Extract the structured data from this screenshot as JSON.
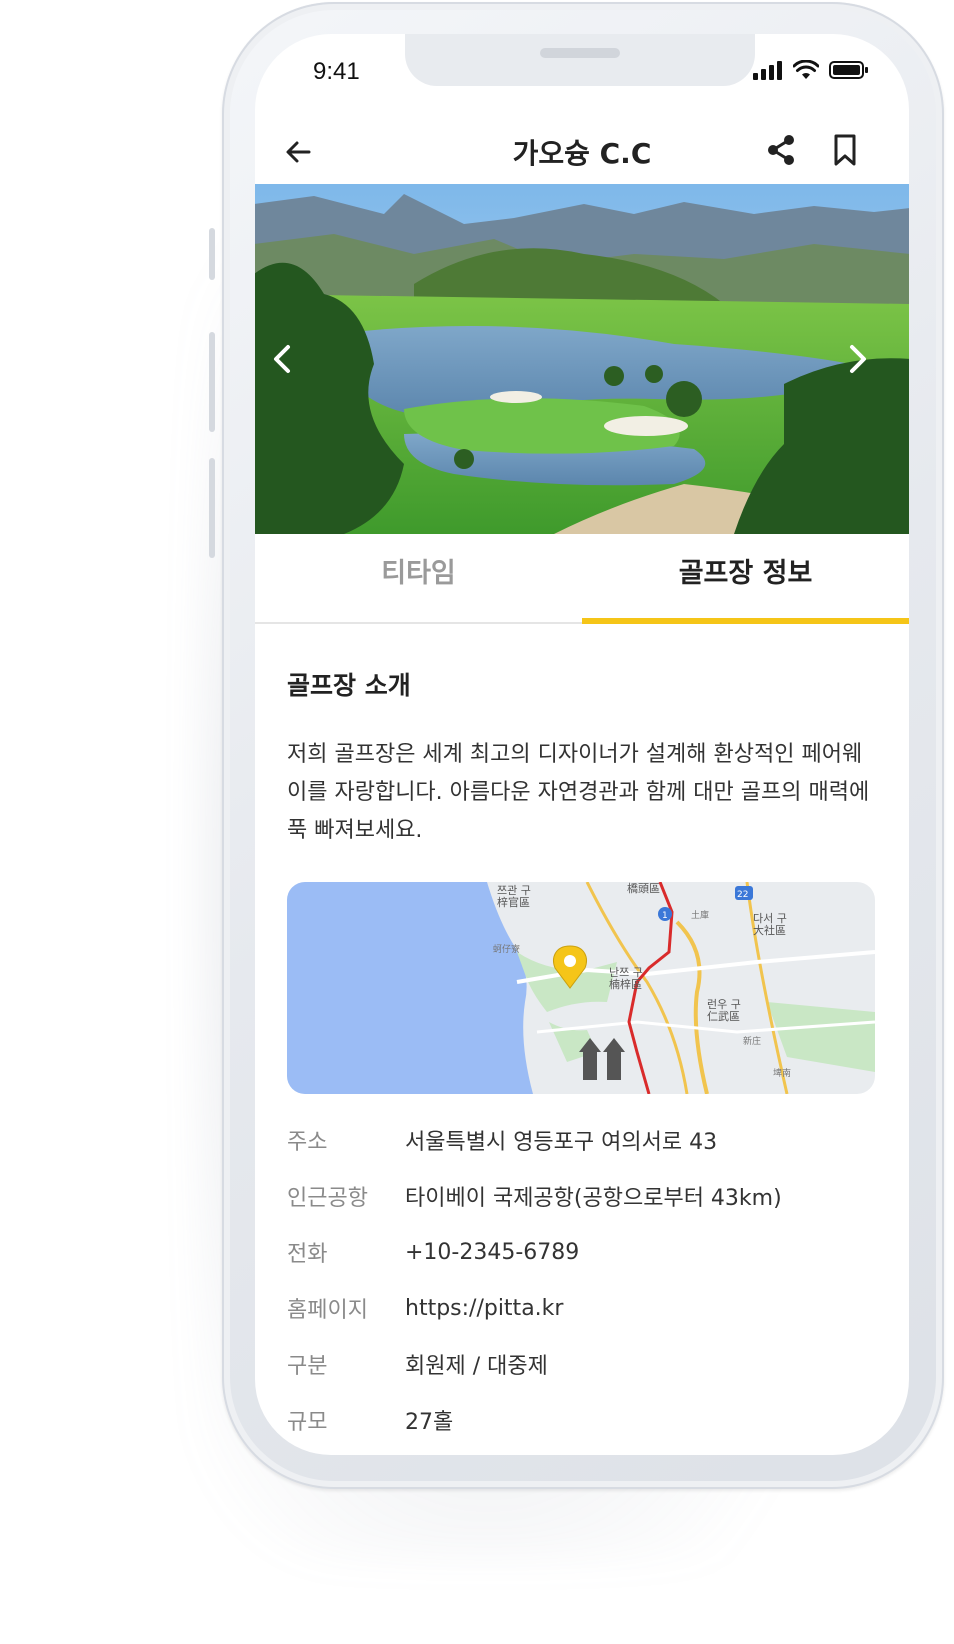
{
  "status_bar": {
    "time": "9:41"
  },
  "header": {
    "title": "가오슝 C.C"
  },
  "tabs": [
    {
      "label": "티타임",
      "active": false
    },
    {
      "label": "골프장 정보",
      "active": true
    }
  ],
  "intro": {
    "title": "골프장 소개",
    "text": "저희 골프장은 세계 최고의 디자이너가 설계해 환상적인 페어웨이를 자랑합니다.  아름다운 자연경관과 함께 대만 골프의 매력에 푹 빠져보세요."
  },
  "map_labels": [
    "쯔관 구",
    "梓官區",
    "橋頭區",
    "22",
    "1",
    "다서 구",
    "大社區",
    "난쯔 구",
    "楠梓區",
    "런우 구",
    "仁武區",
    "蚵仔寮",
    "土庫",
    "新庄",
    "埤南"
  ],
  "info": [
    {
      "label": "주소",
      "value": "서울특별시 영등포구 여의서로 43"
    },
    {
      "label": "인근공항",
      "value": "타이베이 국제공항(공항으로부터 43km)"
    },
    {
      "label": "전화",
      "value": "+10-2345-6789"
    },
    {
      "label": "홈페이지",
      "value": "https://pitta.kr"
    },
    {
      "label": "구분",
      "value": "회원제 / 대중제"
    },
    {
      "label": "규모",
      "value": "27홀"
    }
  ],
  "colors": {
    "accent": "#f5c518",
    "map_water": "#9bbcf5",
    "map_land": "#e9ecef",
    "map_park": "#c9e7c5"
  }
}
